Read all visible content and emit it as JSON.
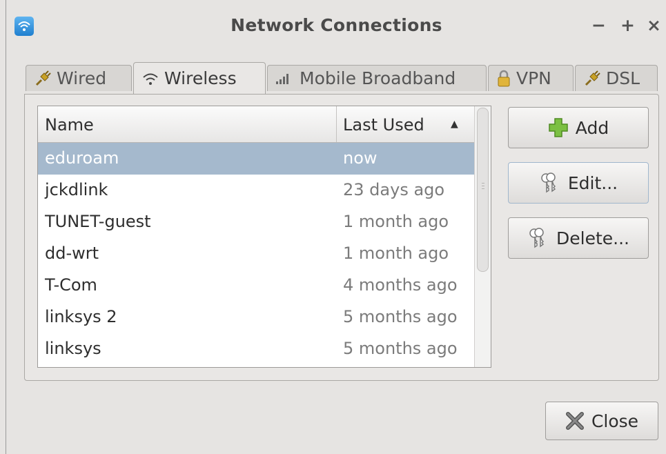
{
  "window": {
    "title": "Network Connections",
    "controls": {
      "minimize": "−",
      "maximize": "+",
      "close": "×"
    }
  },
  "tabs": [
    {
      "label": "Wired",
      "icon": "plug-icon",
      "active": false
    },
    {
      "label": "Wireless",
      "icon": "wifi-icon",
      "active": true
    },
    {
      "label": "Mobile Broadband",
      "icon": "signal-bars-icon",
      "active": false
    },
    {
      "label": "VPN",
      "icon": "lock-icon",
      "active": false
    },
    {
      "label": "DSL",
      "icon": "plug-icon",
      "active": false
    }
  ],
  "connections": {
    "columns": {
      "name": "Name",
      "last_used": "Last Used",
      "sort_indicator": "▲"
    },
    "rows": [
      {
        "name": "eduroam",
        "last_used": "now",
        "selected": true
      },
      {
        "name": "jckdlink",
        "last_used": "23 days ago",
        "selected": false
      },
      {
        "name": "TUNET-guest",
        "last_used": "1 month ago",
        "selected": false
      },
      {
        "name": "dd-wrt",
        "last_used": "1 month ago",
        "selected": false
      },
      {
        "name": "T-Com",
        "last_used": "4 months ago",
        "selected": false
      },
      {
        "name": "linksys 2",
        "last_used": "5 months ago",
        "selected": false
      },
      {
        "name": "linksys",
        "last_used": "5 months ago",
        "selected": false
      }
    ]
  },
  "actions": {
    "add": "Add",
    "edit": "Edit...",
    "delete": "Delete...",
    "close": "Close"
  },
  "colors": {
    "selection": "#a5b9cd",
    "window_bg": "#e6e4e2",
    "add_icon_green": "#7cc043",
    "wifi_icon_blue": "#1f7fcf"
  }
}
